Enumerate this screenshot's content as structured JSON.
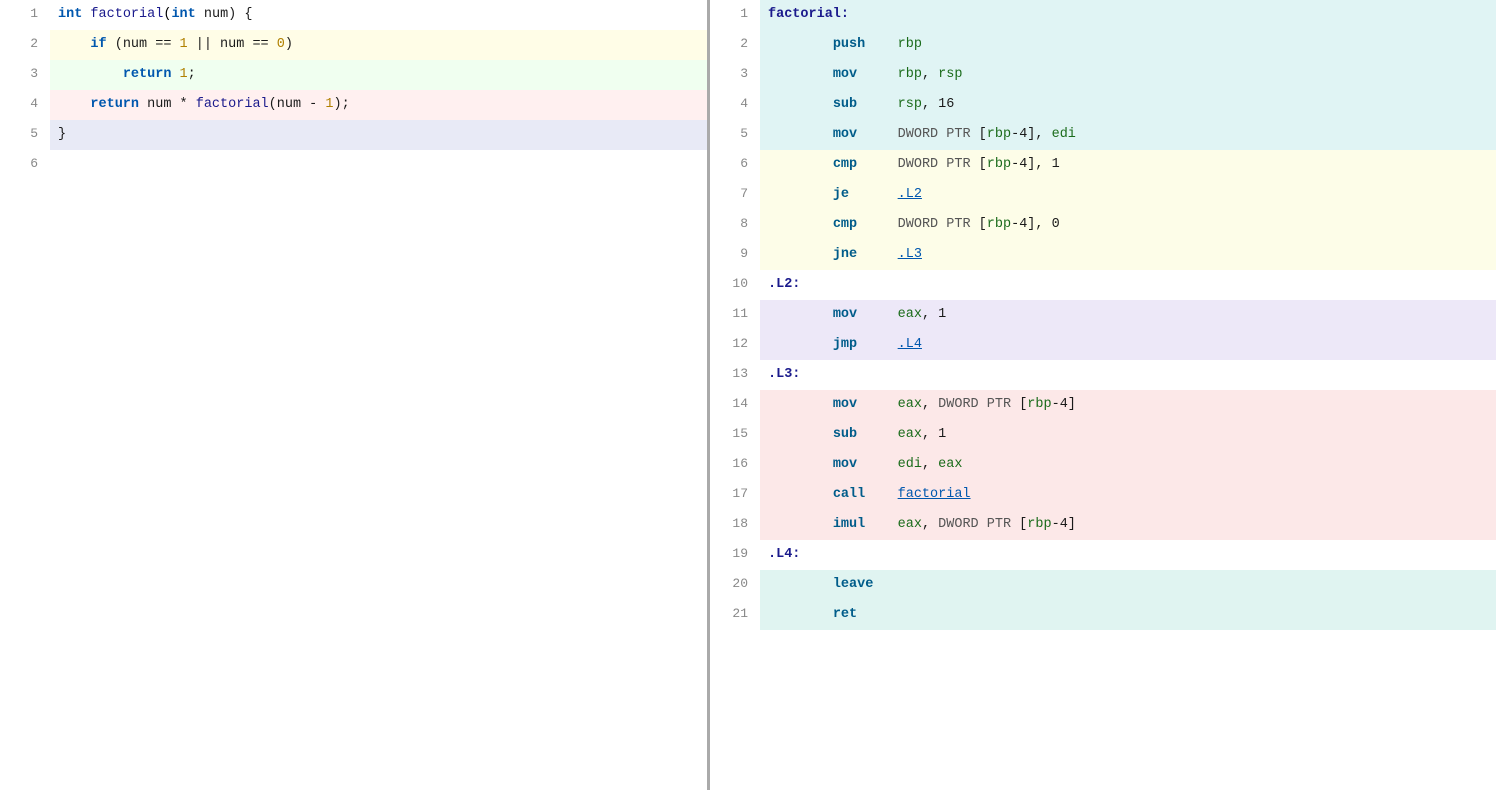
{
  "left": {
    "lines": [
      {
        "num": 1,
        "bg": "line-default",
        "html": "<span class='type'>int</span> <span class='fn'>factorial</span>(<span class='type'>int</span> <span class='plain'>num) {</span>"
      },
      {
        "num": 2,
        "bg": "line-yellow",
        "html": "    <span class='kw'>if</span> <span class='plain'>(num == </span><span class='num'>1</span><span class='plain'> || num == </span><span class='num'>0</span><span class='plain'>)</span>"
      },
      {
        "num": 3,
        "bg": "line-green",
        "html": "        <span class='kw'>return</span> <span class='num'>1</span><span class='plain'>;</span>"
      },
      {
        "num": 4,
        "bg": "line-red",
        "html": "    <span class='kw'>return</span> <span class='plain'>num * </span><span class='fn'>factorial</span><span class='plain'>(num - </span><span class='num'>1</span><span class='plain'>);</span>"
      },
      {
        "num": 5,
        "bg": "line-blue",
        "html": "<span class='plain'>}</span>"
      },
      {
        "num": 6,
        "bg": "line-default",
        "html": ""
      }
    ]
  },
  "right": {
    "lines": [
      {
        "num": 1,
        "bg": "line-teal",
        "html": "<span class='asm-label'>factorial:</span>"
      },
      {
        "num": 2,
        "bg": "line-teal",
        "html": "        <span class='asm-instr'>push</span>    <span class='asm-reg'>rbp</span>"
      },
      {
        "num": 3,
        "bg": "line-teal",
        "html": "        <span class='asm-instr'>mov</span>     <span class='asm-reg'>rbp</span><span class='asm-plain'>, </span><span class='asm-reg'>rsp</span>"
      },
      {
        "num": 4,
        "bg": "line-teal",
        "html": "        <span class='asm-instr'>sub</span>     <span class='asm-reg'>rsp</span><span class='asm-plain'>, </span><span class='asm-num'>16</span>"
      },
      {
        "num": 5,
        "bg": "line-teal",
        "html": "        <span class='asm-instr'>mov</span>     <span class='asm-kw'>DWORD PTR</span> <span class='asm-plain'>[</span><span class='asm-reg'>rbp</span><span class='asm-plain'>-4], </span><span class='asm-reg'>edi</span>"
      },
      {
        "num": 6,
        "bg": "line-asm-yellow",
        "html": "        <span class='asm-instr'>cmp</span>     <span class='asm-kw'>DWORD PTR</span> <span class='asm-plain'>[</span><span class='asm-reg'>rbp</span><span class='asm-plain'>-4], </span><span class='asm-num'>1</span>"
      },
      {
        "num": 7,
        "bg": "line-asm-yellow",
        "html": "        <span class='asm-instr'>je</span>      <span class='asm-link'>.L2</span>"
      },
      {
        "num": 8,
        "bg": "line-asm-yellow",
        "html": "        <span class='asm-instr'>cmp</span>     <span class='asm-kw'>DWORD PTR</span> <span class='asm-plain'>[</span><span class='asm-reg'>rbp</span><span class='asm-plain'>-4], </span><span class='asm-num'>0</span>"
      },
      {
        "num": 9,
        "bg": "line-asm-yellow",
        "html": "        <span class='asm-instr'>jne</span>     <span class='asm-link'>.L3</span>"
      },
      {
        "num": 10,
        "bg": "line-default",
        "html": "<span class='asm-label'>.L2:</span>"
      },
      {
        "num": 11,
        "bg": "line-asm-purple",
        "html": "        <span class='asm-instr'>mov</span>     <span class='asm-reg'>eax</span><span class='asm-plain'>, </span><span class='asm-num'>1</span>"
      },
      {
        "num": 12,
        "bg": "line-asm-purple",
        "html": "        <span class='asm-instr'>jmp</span>     <span class='asm-link'>.L4</span>"
      },
      {
        "num": 13,
        "bg": "line-default",
        "html": "<span class='asm-label'>.L3:</span>"
      },
      {
        "num": 14,
        "bg": "line-asm-red",
        "html": "        <span class='asm-instr'>mov</span>     <span class='asm-reg'>eax</span><span class='asm-plain'>, </span><span class='asm-kw'>DWORD PTR</span> <span class='asm-plain'>[</span><span class='asm-reg'>rbp</span><span class='asm-plain'>-4]</span>"
      },
      {
        "num": 15,
        "bg": "line-asm-red",
        "html": "        <span class='asm-instr'>sub</span>     <span class='asm-reg'>eax</span><span class='asm-plain'>, </span><span class='asm-num'>1</span>"
      },
      {
        "num": 16,
        "bg": "line-asm-red",
        "html": "        <span class='asm-instr'>mov</span>     <span class='asm-reg'>edi</span><span class='asm-plain'>, </span><span class='asm-reg'>eax</span>"
      },
      {
        "num": 17,
        "bg": "line-asm-red",
        "html": "        <span class='asm-instr'>call</span>    <span class='asm-link' style='text-decoration:underline'>factorial</span>"
      },
      {
        "num": 18,
        "bg": "line-asm-red",
        "html": "        <span class='asm-instr'>imul</span>    <span class='asm-reg'>eax</span><span class='asm-plain'>, </span><span class='asm-kw'>DWORD PTR</span> <span class='asm-plain'>[</span><span class='asm-reg'>rbp</span><span class='asm-plain'>-4]</span>"
      },
      {
        "num": 19,
        "bg": "line-default",
        "html": "<span class='asm-label'>.L4:</span>"
      },
      {
        "num": 20,
        "bg": "line-asm-teal2",
        "html": "        <span class='asm-instr'>leave</span>"
      },
      {
        "num": 21,
        "bg": "line-asm-teal2",
        "html": "        <span class='asm-instr'>ret</span>"
      }
    ]
  }
}
